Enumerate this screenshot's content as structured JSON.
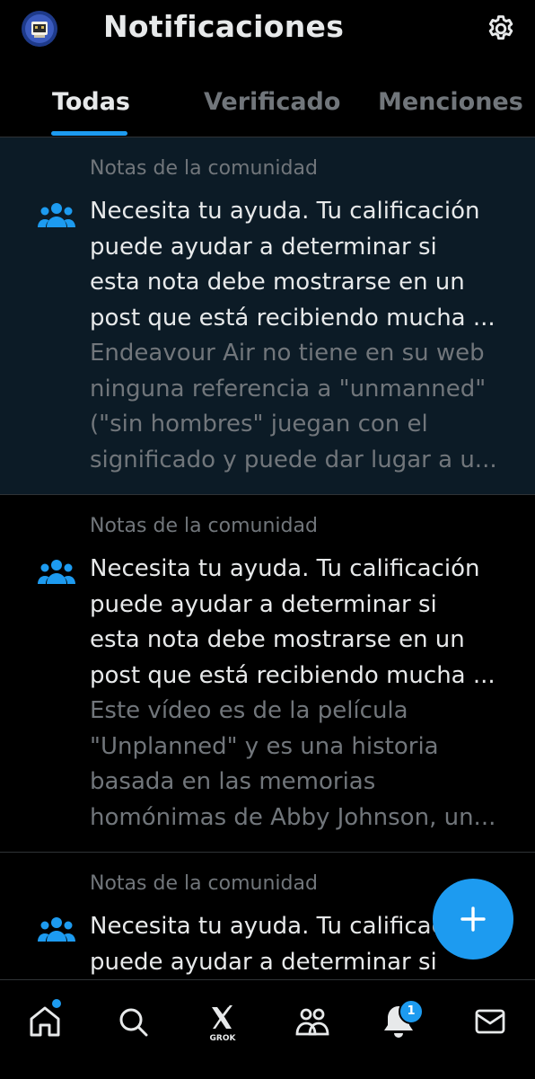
{
  "header": {
    "title": "Notificaciones",
    "settings_icon": "gear-icon",
    "avatar_icon": "profile-avatar"
  },
  "tabs": [
    {
      "label": "Todas",
      "active": true
    },
    {
      "label": "Verificado",
      "active": false
    },
    {
      "label": "Menciones",
      "active": false
    }
  ],
  "notifications": [
    {
      "kind": "Notas de la comunidad",
      "icon": "community-people-icon",
      "lines": [
        "Necesita tu ayuda. Tu calificación",
        "puede ayudar a determinar si",
        "esta nota debe mostrarse en un",
        "post que está recibiendo mucha ..."
      ],
      "preview_lines": [
        "Endeavour Air no tiene en su web",
        "ninguna referencia a \"unmanned\"",
        "(\"sin hombres\" juegan con el",
        "significado y puede dar lugar a u..."
      ]
    },
    {
      "kind": "Notas de la comunidad",
      "icon": "community-people-icon",
      "lines": [
        "Necesita tu ayuda. Tu calificación",
        "puede ayudar a determinar si",
        "esta nota debe mostrarse en un",
        "post que está recibiendo mucha ..."
      ],
      "preview_lines": [
        "Este vídeo es de la película",
        "\"Unplanned\" y es una historia",
        "basada en las memorias",
        "homónimas de Abby Johnson, un..."
      ]
    },
    {
      "kind": "Notas de la comunidad",
      "icon": "community-people-icon",
      "lines": [
        "Necesita tu ayuda. Tu calificación",
        "puede ayudar a determinar si"
      ]
    }
  ],
  "fab": {
    "icon": "plus-icon"
  },
  "bottom_nav": [
    {
      "name": "home",
      "icon": "home-icon"
    },
    {
      "name": "search",
      "icon": "search-icon"
    },
    {
      "name": "grok",
      "icon": "grok-icon",
      "label": "GROK"
    },
    {
      "name": "communities",
      "icon": "communities-icon"
    },
    {
      "name": "notifications",
      "icon": "bell-icon",
      "badge": "1"
    },
    {
      "name": "messages",
      "icon": "mail-icon"
    }
  ],
  "colors": {
    "accent": "#1d9bf0",
    "background": "#000000",
    "highlight_row": "#0c1b26",
    "muted_text": "#71767b",
    "primary_text": "#e7e9ea"
  }
}
